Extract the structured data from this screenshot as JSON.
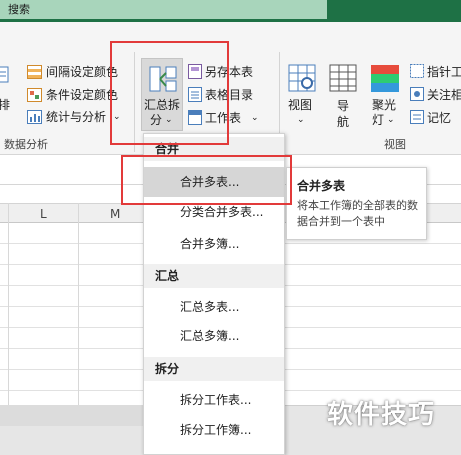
{
  "topbar": {
    "search_label": "搜索"
  },
  "ribbon": {
    "left_group": {
      "item_a": "间隔设定颜色",
      "item_b": "条件设定颜色",
      "item_c": "统计与分析",
      "cut_label": "排",
      "group_label": "数据分析"
    },
    "summary_button": {
      "line1": "汇总拆",
      "line2": "分"
    },
    "middle": {
      "item_a": "另存本表",
      "item_b": "表格目录",
      "item_c": "工作表"
    },
    "view_group": {
      "view_label": "视图",
      "nav_label": "导航",
      "spotlight_label": "聚光灯",
      "group_label": "视图",
      "right_a": "指针工",
      "right_b": "关注相",
      "right_c": "记忆"
    }
  },
  "columns": [
    "L",
    "M"
  ],
  "dropdown": {
    "sections": [
      {
        "header": "合并",
        "items": [
          "合并多表...",
          "分类合并多表...",
          "合并多簿..."
        ]
      },
      {
        "header": "汇总",
        "items": [
          "汇总多表...",
          "汇总多簿..."
        ]
      },
      {
        "header": "拆分",
        "items": [
          "拆分工作表...",
          "拆分工作簿..."
        ]
      }
    ],
    "hovered_item": "合并多表..."
  },
  "tooltip": {
    "title": "合并多表",
    "description": "将本工作簿的全部表的数据合并到一个表中"
  },
  "watermark": "软件技巧",
  "colors": {
    "excel_green": "#1e7145",
    "highlight_red": "#e23a3a",
    "hover_gray": "#d6d6d6"
  }
}
